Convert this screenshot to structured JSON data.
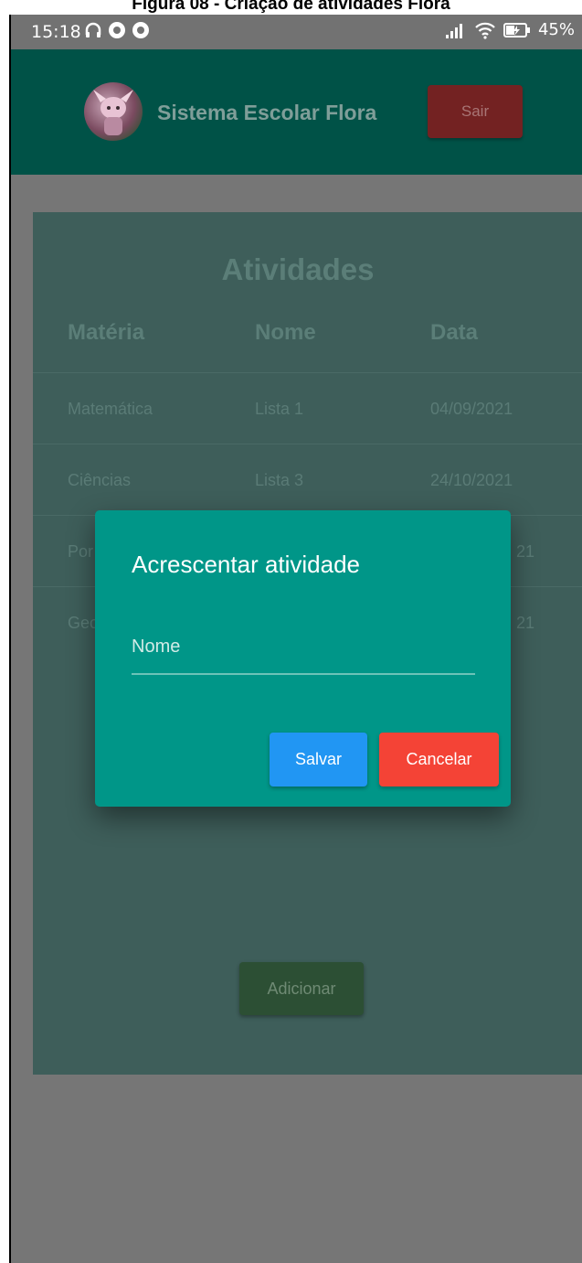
{
  "caption": "Figura 08 - Criação de atividades Flora",
  "status_bar": {
    "time": "15:18",
    "battery": "45%"
  },
  "header": {
    "title": "Sistema Escolar Flora",
    "logout_label": "Sair"
  },
  "activities": {
    "title": "Atividades",
    "columns": [
      "Matéria",
      "Nome",
      "Data"
    ],
    "rows": [
      [
        "Matemática",
        "Lista 1",
        "04/09/2021"
      ],
      [
        "Ciências",
        "Lista 3",
        "24/10/2021"
      ],
      [
        "Por",
        "",
        "21"
      ],
      [
        "Geo",
        "",
        "21"
      ]
    ],
    "add_label": "Adicionar"
  },
  "dialog": {
    "title": "Acrescentar atividade",
    "name_placeholder": "Nome",
    "name_value": "",
    "save_label": "Salvar",
    "cancel_label": "Cancelar"
  },
  "colors": {
    "app_bar": "#005247",
    "dialog": "#009688",
    "save": "#2196f3",
    "cancel": "#f44336",
    "add": "#2c4f34",
    "logout": "#732222"
  },
  "icons": [
    "headphones-icon",
    "notification-icon",
    "notification-icon",
    "signal-icon",
    "wifi-icon",
    "battery-charging-icon"
  ]
}
